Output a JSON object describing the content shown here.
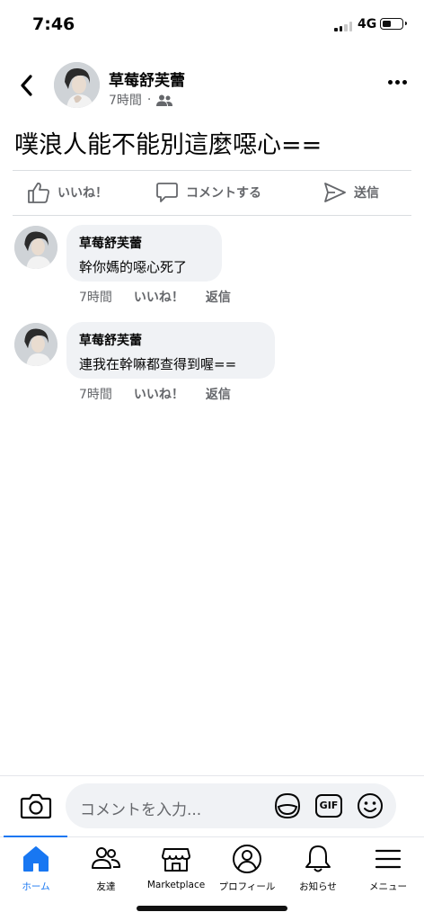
{
  "status_bar": {
    "time": "7:46",
    "network": "4G",
    "battery_level": 0.45
  },
  "post": {
    "author": "草莓舒芙蕾",
    "time": "7時間",
    "audience_icon": "friends-icon",
    "text": "噗浪人能不能別這麼噁心=="
  },
  "actions": {
    "like": "いいね！",
    "comment": "コメントする",
    "share": "送信"
  },
  "comments": [
    {
      "author": "草莓舒芙蕾",
      "text": "幹你媽的噁心死了",
      "time": "7時間",
      "like": "いいね！",
      "reply": "返信"
    },
    {
      "author": "草莓舒芙蕾",
      "text": "連我在幹嘛都查得到喔==",
      "time": "7時間",
      "like": "いいね！",
      "reply": "返信"
    }
  ],
  "composer": {
    "placeholder": "コメントを入力...",
    "gif_label": "GIF"
  },
  "tabs": [
    {
      "label": "ホーム",
      "icon": "home-icon",
      "active": true
    },
    {
      "label": "友達",
      "icon": "friends-icon"
    },
    {
      "label": "Marketplace",
      "icon": "marketplace-icon"
    },
    {
      "label": "プロフィール",
      "icon": "profile-icon"
    },
    {
      "label": "お知らせ",
      "icon": "bell-icon"
    },
    {
      "label": "メニュー",
      "icon": "menu-icon"
    }
  ],
  "colors": {
    "accent": "#1877f2",
    "secondary_text": "#65676b",
    "bubble": "#f0f2f5"
  }
}
